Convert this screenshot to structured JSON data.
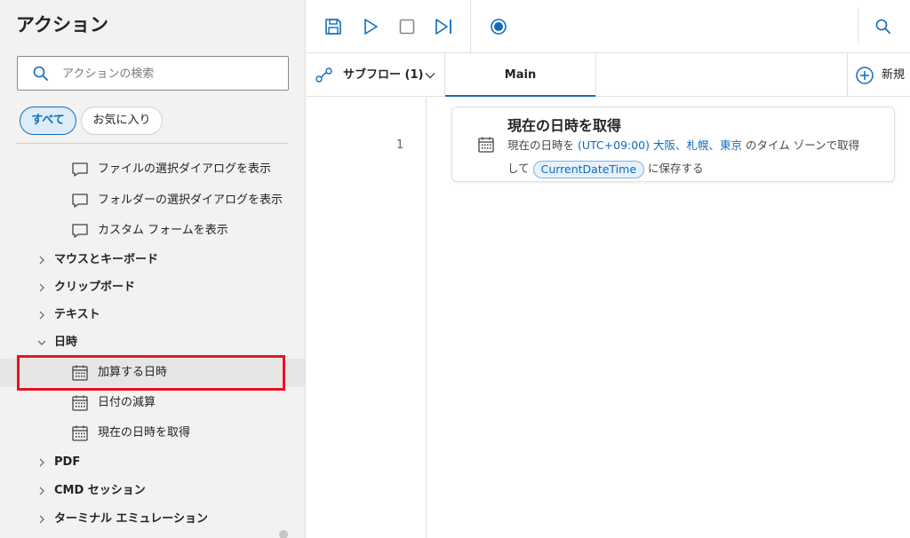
{
  "actions_pane": {
    "title": "アクション",
    "search_placeholder": "アクションの検索",
    "filters": {
      "all": "すべて",
      "favorites": "お気に入り"
    },
    "tree": [
      {
        "label": "ファイルの選択ダイアログを表示",
        "icon": "dialog-icon"
      },
      {
        "label": "フォルダーの選択ダイアログを表示",
        "icon": "dialog-icon"
      },
      {
        "label": "カスタム フォームを表示",
        "icon": "dialog-icon"
      }
    ],
    "groups": {
      "mouse_keyboard": "マウスとキーボード",
      "clipboard": "クリップボード",
      "text": "テキスト",
      "datetime": "日時",
      "pdf": "PDF",
      "cmd": "CMD セッション",
      "terminal": "ターミナル エミュレーション"
    },
    "datetime_items": [
      {
        "label": "加算する日時",
        "icon": "calendar-icon",
        "highlighted": true
      },
      {
        "label": "日付の減算",
        "icon": "calendar-icon"
      },
      {
        "label": "現在の日時を取得",
        "icon": "calendar-icon"
      }
    ]
  },
  "toolbar": {
    "icons": [
      "save-icon",
      "run-icon",
      "stop-icon",
      "step-icon",
      "record-icon",
      "search-icon"
    ]
  },
  "tabs": {
    "subflow_label": "サブフロー (1)",
    "main_label": "Main",
    "new_label": "新規"
  },
  "flow": {
    "steps": [
      {
        "line": "1",
        "title": "現在の日時を取得",
        "desc_prefix": "現在の日時を ",
        "timezone": "(UTC+09:00) 大阪、札幌、東京",
        "desc_mid": " のタイム ゾーンで取得",
        "desc_line2_prefix": "して ",
        "variable": "CurrentDateTime",
        "desc_suffix": " に保存する"
      }
    ]
  },
  "colors": {
    "accent": "#0f6cbd",
    "highlight_border": "#e81123",
    "pane_bg": "#f3f2f1"
  }
}
